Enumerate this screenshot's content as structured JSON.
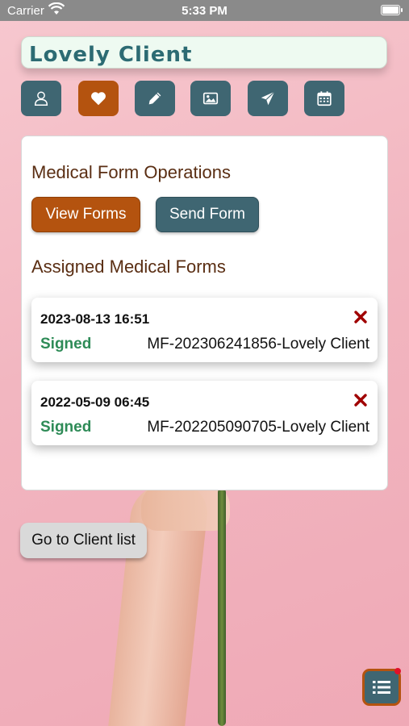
{
  "status_bar": {
    "carrier": "Carrier",
    "time": "5:33 PM"
  },
  "client": {
    "name": "Lovely Client"
  },
  "toolbar": {
    "buttons": [
      {
        "icon": "user-icon"
      },
      {
        "icon": "heart-icon",
        "active": true
      },
      {
        "icon": "pencil-icon"
      },
      {
        "icon": "image-icon"
      },
      {
        "icon": "paper-plane-icon"
      },
      {
        "icon": "calendar-icon"
      }
    ]
  },
  "medical": {
    "operations_title": "Medical Form Operations",
    "view_forms_label": "View Forms",
    "send_form_label": "Send Form",
    "assigned_title": "Assigned Medical Forms",
    "forms": [
      {
        "date": "2023-08-13 16:51",
        "status": "Signed",
        "name": "MF-202306241856-Lovely Client"
      },
      {
        "date": "2022-05-09 06:45",
        "status": "Signed",
        "name": "MF-202205090705-Lovely Client"
      }
    ]
  },
  "nav": {
    "go_client_list_label": "Go to Client list"
  },
  "colors": {
    "accent_orange": "#b4530f",
    "accent_teal": "#3f6672",
    "signed_green": "#2e8b57",
    "delete_red": "#a00000"
  }
}
